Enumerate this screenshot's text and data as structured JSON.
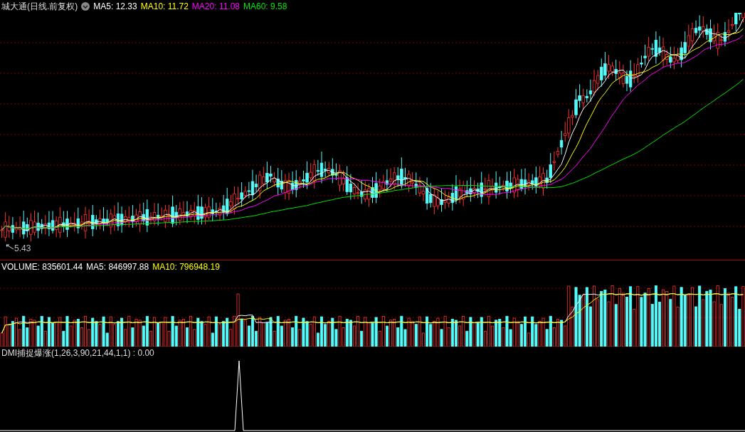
{
  "price_panel": {
    "title": "城大通(日线.前复权)",
    "indicators": [
      {
        "label": "MA5: 12.33",
        "color": "#ffffff"
      },
      {
        "label": "MA10: 11.72",
        "color": "#ffff00"
      },
      {
        "label": "MA20: 11.08",
        "color": "#ff00ff"
      },
      {
        "label": "MA60: 9.58",
        "color": "#00e600"
      }
    ],
    "low_label": "5.43"
  },
  "volume_panel": {
    "indicators": [
      {
        "label": "VOLUME: 835601.44",
        "color": "#ffffff"
      },
      {
        "label": "MA5: 846997.88",
        "color": "#ffffff"
      },
      {
        "label": "MA10: 796948.19",
        "color": "#ffff00"
      }
    ]
  },
  "indicator_panel": {
    "label": "DMI捕捉爆涨(1,26,3,90,21,44,1,1) : 0.00"
  }
}
